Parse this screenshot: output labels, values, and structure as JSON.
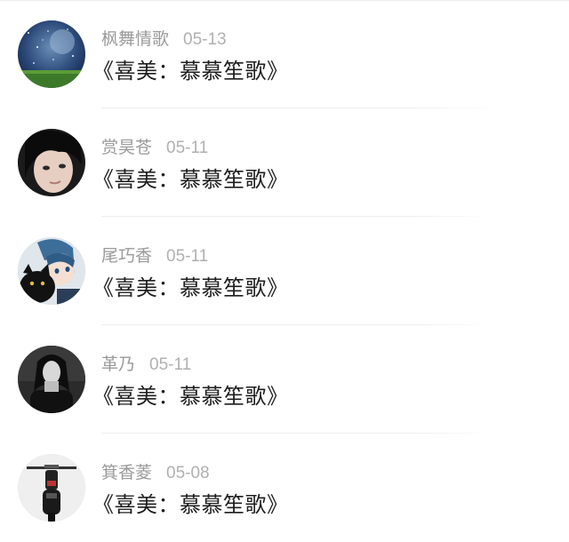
{
  "comments": [
    {
      "author": "枫舞情歌",
      "date": "05-13",
      "text": "《喜美：慕慕笙歌》",
      "avatar_icon": "night-sky-avatar"
    },
    {
      "author": "赏昊苍",
      "date": "05-11",
      "text": "《喜美：慕慕笙歌》",
      "avatar_icon": "dark-hair-portrait-avatar"
    },
    {
      "author": "尾巧香",
      "date": "05-11",
      "text": "《喜美：慕慕笙歌》",
      "avatar_icon": "anime-boy-with-cat-avatar"
    },
    {
      "author": "革乃",
      "date": "05-11",
      "text": "《喜美：慕慕笙歌》",
      "avatar_icon": "monochrome-girl-portrait-avatar"
    },
    {
      "author": "箕香菱",
      "date": "05-08",
      "text": "《喜美：慕慕笙歌》",
      "avatar_icon": "motorcycle-avatar"
    }
  ]
}
